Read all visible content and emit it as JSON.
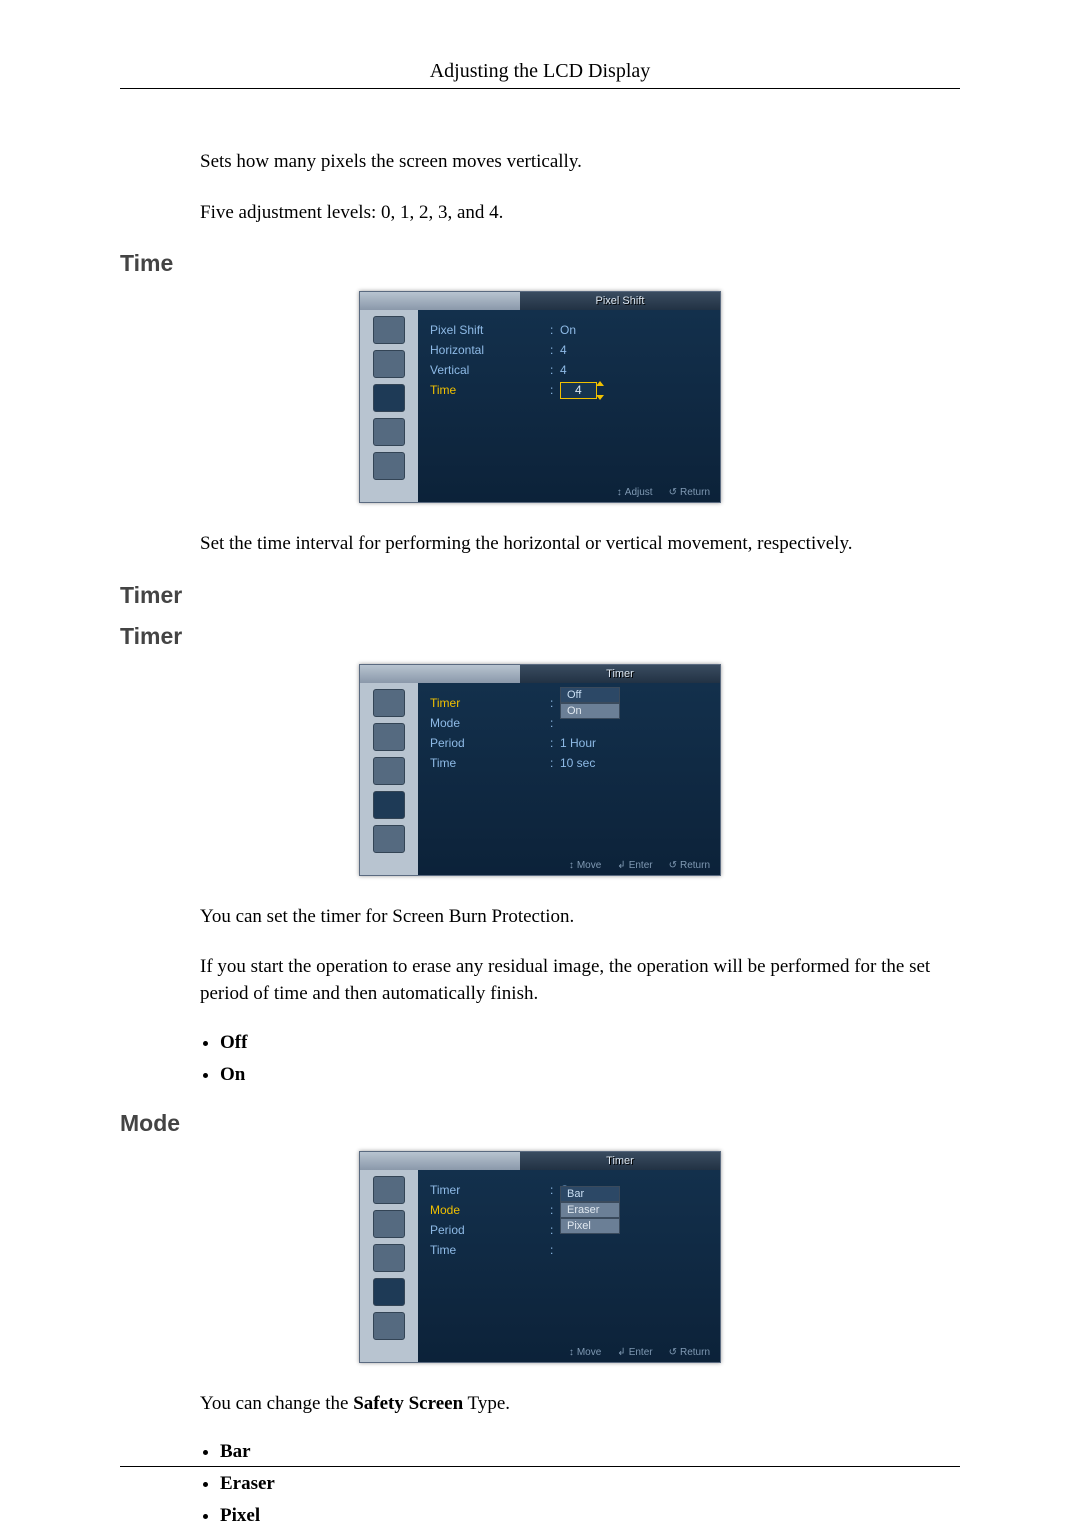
{
  "header": {
    "title": "Adjusting the LCD Display"
  },
  "intro": {
    "para1": "Sets how many pixels the screen moves vertically.",
    "para2": "Five adjustment levels: 0, 1, 2, 3, and 4."
  },
  "sections": {
    "time": {
      "heading": "Time",
      "osd": {
        "title": "Pixel Shift",
        "rows": [
          {
            "label": "Pixel Shift",
            "value": "On"
          },
          {
            "label": "Horizontal",
            "value": "4"
          },
          {
            "label": "Vertical",
            "value": "4"
          },
          {
            "label": "Time",
            "value": "4",
            "selected": true,
            "spinner": true
          }
        ],
        "footer": [
          {
            "icon": "updown",
            "label": "Adjust"
          },
          {
            "icon": "return",
            "label": "Return"
          }
        ]
      },
      "para": "Set the time interval for performing the horizontal or vertical movement, respectively."
    },
    "timer": {
      "heading1": "Timer",
      "heading2": "Timer",
      "osd": {
        "title": "Timer",
        "rows": [
          {
            "label": "Timer",
            "selected": true,
            "dropdown": [
              "Off",
              "On"
            ],
            "current": "Off"
          },
          {
            "label": "Mode",
            "value": ""
          },
          {
            "label": "Period",
            "value": "1 Hour"
          },
          {
            "label": "Time",
            "value": "10 sec"
          }
        ],
        "footer": [
          {
            "icon": "updown",
            "label": "Move"
          },
          {
            "icon": "enter",
            "label": "Enter"
          },
          {
            "icon": "return",
            "label": "Return"
          }
        ]
      },
      "para1": "You can set the timer for Screen Burn Protection.",
      "para2": "If you start the operation to erase any residual image, the operation will be performed for the set period of time and then automatically finish.",
      "bullets": [
        "Off",
        "On"
      ]
    },
    "mode": {
      "heading": "Mode",
      "osd": {
        "title": "Timer",
        "rows": [
          {
            "label": "Timer",
            "value": "On"
          },
          {
            "label": "Mode",
            "selected": true,
            "dropdown": [
              "Bar",
              "Eraser",
              "Pixel"
            ],
            "current": "Bar"
          },
          {
            "label": "Period",
            "value": ""
          },
          {
            "label": "Time",
            "value": ""
          }
        ],
        "footer": [
          {
            "icon": "updown",
            "label": "Move"
          },
          {
            "icon": "enter",
            "label": "Enter"
          },
          {
            "icon": "return",
            "label": "Return"
          }
        ]
      },
      "para_prefix": "You can change the ",
      "para_bold": "Safety Screen",
      "para_suffix": " Type.",
      "bullets": [
        "Bar",
        "Eraser",
        "Pixel"
      ]
    }
  }
}
